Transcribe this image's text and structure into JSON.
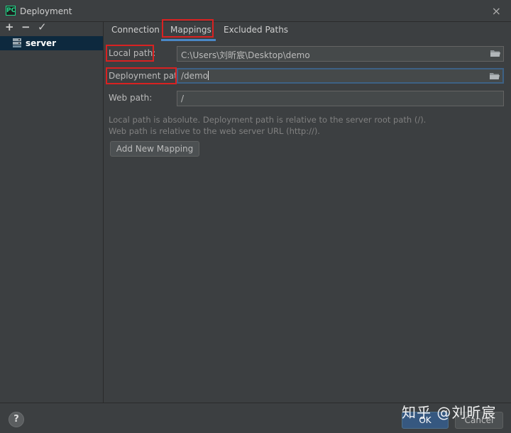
{
  "window": {
    "title": "Deployment",
    "close_symbol": "×",
    "app_icon_text": "PC"
  },
  "toolbar": {
    "add": "+",
    "remove": "−",
    "apply": "✓"
  },
  "tree": {
    "items": [
      {
        "label": "server"
      }
    ]
  },
  "tabs": [
    {
      "label": "Connection"
    },
    {
      "label": "Mappings",
      "selected": true
    },
    {
      "label": "Excluded Paths"
    }
  ],
  "mappings": {
    "local_path": {
      "label": "Local path:",
      "value": "C:\\Users\\刘昕宸\\Desktop\\demo"
    },
    "deployment_path": {
      "label": "Deployment path:",
      "value": "/demo"
    },
    "web_path": {
      "label": "Web path:",
      "value": "/"
    },
    "hint_line1": "Local path is absolute. Deployment path is relative to the server root path (/).",
    "hint_line2": "Web path is relative to the web server URL (http://).",
    "add_button": "Add New Mapping"
  },
  "footer": {
    "help": "?",
    "ok": "OK",
    "cancel": "Cancel"
  },
  "watermark": "知乎 @刘昕宸",
  "colors": {
    "background": "#3c3f41",
    "selection": "#0d293e",
    "accent": "#4a88c7",
    "highlight_box": "#d92121"
  }
}
